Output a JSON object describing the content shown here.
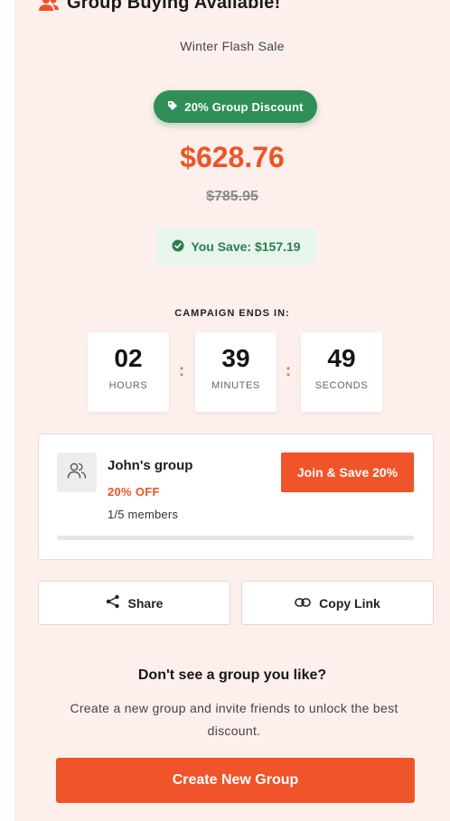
{
  "header": {
    "title": "Group Buying Available!",
    "icon": "users-icon"
  },
  "campaign": {
    "name": "Winter Flash Sale"
  },
  "discount_badge": {
    "label": "20% Group Discount",
    "icon": "tag-icon"
  },
  "pricing": {
    "price": "$628.76",
    "original_price": "$785.95",
    "savings_label": "You Save: $157.19"
  },
  "countdown": {
    "label": "CAMPAIGN ENDS IN:",
    "hours": "02",
    "hours_label": "HOURS",
    "minutes": "39",
    "minutes_label": "MINUTES",
    "seconds": "49",
    "seconds_label": "SECONDS",
    "separator": ":"
  },
  "group": {
    "name": "John's group",
    "discount": "20% OFF",
    "members": "1/5 members",
    "progress": 0,
    "join_label": "Join & Save 20%"
  },
  "actions": {
    "share_label": "Share",
    "copy_label": "Copy Link"
  },
  "create": {
    "heading": "Don't see a group you like?",
    "text": "Create a new group and invite friends to unlock the best discount.",
    "button_label": "Create New Group"
  },
  "colors": {
    "accent": "#f0542a",
    "panel_bg": "#fdf0ec",
    "success": "#2f8f57",
    "success_bg": "#e6f6ec"
  }
}
